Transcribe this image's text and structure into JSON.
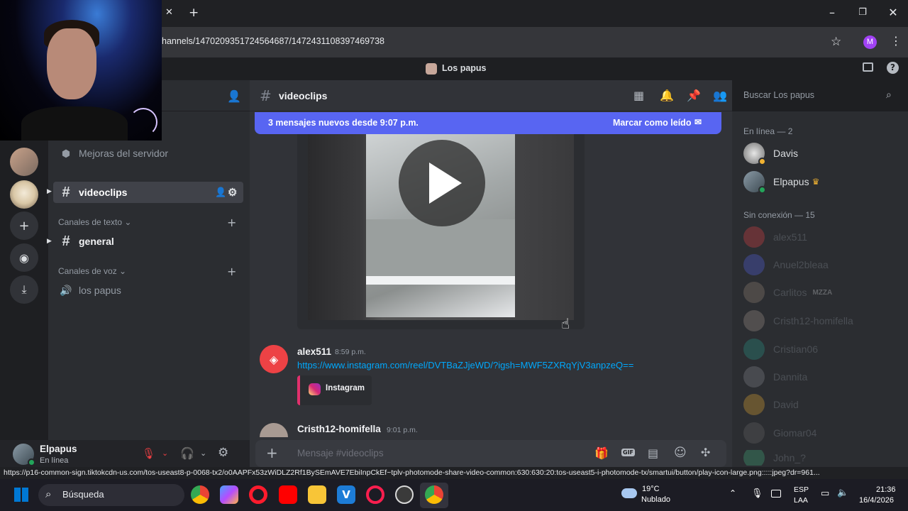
{
  "browser": {
    "url": "hannels/1470209351724564687/1472431108397469738",
    "profile_initial": "M"
  },
  "discord": {
    "server_title": "Los papus",
    "sidebar": {
      "boost_label": "Mejoras del servidor",
      "selected_channel": "videoclips",
      "text_category": "Canales de texto",
      "text_channels": [
        "general"
      ],
      "voice_category": "Canales de voz",
      "voice_channels": [
        "los papus"
      ]
    },
    "user_panel": {
      "name": "Elpapus",
      "status": "En línea"
    },
    "channel_header": {
      "name": "videoclips",
      "search_placeholder": "Buscar Los papus"
    },
    "new_messages_bar": {
      "text": "3 mensajes nuevos desde 9:07 p.m.",
      "action": "Marcar como leído"
    },
    "messages": [
      {
        "author": "alex511",
        "time": "8:59 p.m.",
        "link": "https://www.instagram.com/reel/DVTBaZJjeWD/?igsh=MWF5ZXRqYjV3anpzeQ==",
        "embed_provider": "Instagram"
      },
      {
        "author": "Cristh12-homifella",
        "time": "9:01 p.m."
      }
    ],
    "composer_placeholder": "Mensaje #videoclips",
    "members": {
      "online_header": "En línea — 2",
      "online": [
        {
          "name": "Davis",
          "status": "idle"
        },
        {
          "name": "Elpapus",
          "status": "online",
          "badge": "♛"
        }
      ],
      "offline_header": "Sin conexión — 15",
      "offline": [
        {
          "name": "alex511"
        },
        {
          "name": "Anuel2bleaa"
        },
        {
          "name": "Carlitos",
          "tag": "MZZA"
        },
        {
          "name": "Cristh12-homifella"
        },
        {
          "name": "Cristian06"
        },
        {
          "name": "Dannita"
        },
        {
          "name": "David"
        },
        {
          "name": "Giomar04"
        },
        {
          "name": "John_?"
        }
      ]
    }
  },
  "status_url": "https://p16-common-sign.tiktokcdn-us.com/tos-useast8-p-0068-tx2/o0AAPFx53zWiDLZ2Rf1BySEmAVE7EbiInpCkEf~tplv-photomode-share-video-common:630:630:20:tos-useast5-i-photomode-tx/smartui/button/play-icon-large.png:::::jpeg?dr=961...",
  "taskbar": {
    "search_label": "Búsqueda",
    "weather_temp": "19°C",
    "weather_desc": "Nublado",
    "lang_top": "ESP",
    "lang_bottom": "LAA",
    "time": "21:36",
    "date": "16/4/2026"
  },
  "colors": {
    "blurple": "#5865f2",
    "link": "#00a8fc",
    "online": "#23a55a",
    "idle": "#f0b232"
  }
}
